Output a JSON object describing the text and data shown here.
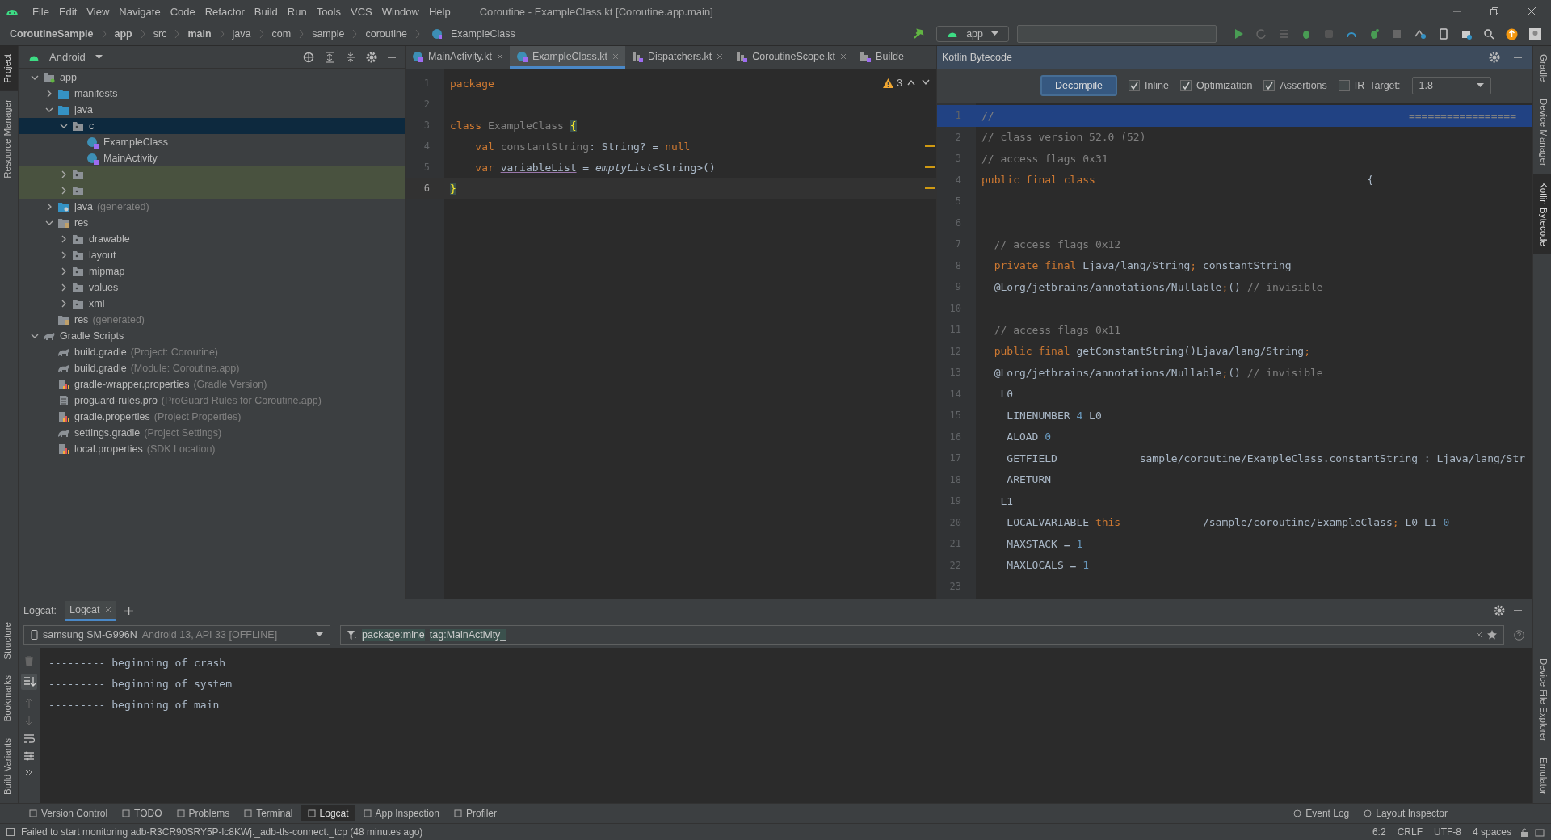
{
  "window": {
    "title": "Coroutine - ExampleClass.kt [Coroutine.app.main]",
    "menu": [
      "File",
      "Edit",
      "View",
      "Navigate",
      "Code",
      "Refactor",
      "Build",
      "Run",
      "Tools",
      "VCS",
      "Window",
      "Help"
    ]
  },
  "breadcrumbs": [
    {
      "label": "CoroutineSample",
      "bold": true
    },
    {
      "label": "app",
      "bold": true
    },
    {
      "label": "src",
      "bold": false
    },
    {
      "label": "main",
      "bold": true
    },
    {
      "label": "java",
      "bold": false
    },
    {
      "label": "com",
      "bold": false
    },
    {
      "label": "sample",
      "bold": false
    },
    {
      "label": "coroutine",
      "bold": false
    },
    {
      "label": "ExampleClass",
      "bold": false,
      "kind": "kotlin"
    }
  ],
  "run_config": "app",
  "left_stripe": [
    {
      "label": "Project",
      "selected": true
    },
    {
      "label": "Resource Manager",
      "selected": false
    },
    {
      "label": "Structure",
      "selected": false
    },
    {
      "label": "Bookmarks",
      "selected": false
    },
    {
      "label": "Build Variants",
      "selected": false
    }
  ],
  "right_stripe": [
    {
      "label": "Gradle",
      "selected": false
    },
    {
      "label": "Device Manager",
      "selected": false
    },
    {
      "label": "Kotlin Bytecode",
      "selected": true
    },
    {
      "label": "Device File Explorer",
      "selected": false
    },
    {
      "label": "Emulator",
      "selected": false
    }
  ],
  "project": {
    "view": "Android",
    "tree": [
      {
        "label": "app",
        "kind": "module",
        "expanded": true,
        "children": [
          {
            "label": "manifests",
            "kind": "folder",
            "expanded": false
          },
          {
            "label": "java",
            "kind": "folder",
            "expanded": true,
            "children": [
              {
                "label": "c",
                "kind": "package",
                "expanded": true,
                "selected": true,
                "children": [
                  {
                    "label": "ExampleClass",
                    "kind": "kotlin"
                  },
                  {
                    "label": "MainActivity",
                    "kind": "kotlin"
                  }
                ]
              },
              {
                "kind": "package",
                "expanded": false,
                "highlighted": true
              },
              {
                "kind": "package",
                "expanded": false,
                "highlighted": true
              }
            ]
          },
          {
            "label": "java",
            "note": "(generated)",
            "kind": "generated",
            "expanded": false
          },
          {
            "label": "res",
            "kind": "res",
            "expanded": true,
            "children": [
              {
                "label": "drawable",
                "kind": "package",
                "expanded": false
              },
              {
                "label": "layout",
                "kind": "package",
                "expanded": false
              },
              {
                "label": "mipmap",
                "kind": "package",
                "expanded": false
              },
              {
                "label": "values",
                "kind": "package",
                "expanded": false
              },
              {
                "label": "xml",
                "kind": "package",
                "expanded": false
              }
            ]
          },
          {
            "label": "res",
            "note": "(generated)",
            "kind": "res"
          }
        ]
      },
      {
        "label": "Gradle Scripts",
        "kind": "gradle",
        "expanded": true,
        "children": [
          {
            "label": "build.gradle",
            "note": "(Project: Coroutine)",
            "kind": "gradle"
          },
          {
            "label": "build.gradle",
            "note": "(Module: Coroutine.app)",
            "kind": "gradle"
          },
          {
            "label": "gradle-wrapper.properties",
            "note": "(Gradle Version)",
            "kind": "props"
          },
          {
            "label": "proguard-rules.pro",
            "note": "(ProGuard Rules for Coroutine.app)",
            "kind": "file"
          },
          {
            "label": "gradle.properties",
            "note": "(Project Properties)",
            "kind": "props"
          },
          {
            "label": "settings.gradle",
            "note": "(Project Settings)",
            "kind": "gradle"
          },
          {
            "label": "local.properties",
            "note": "(SDK Location)",
            "kind": "props"
          }
        ]
      }
    ]
  },
  "editor": {
    "tabs": [
      {
        "label": "MainActivity.kt",
        "kind": "kotlin",
        "selected": false
      },
      {
        "label": "ExampleClass.kt",
        "kind": "kotlin",
        "selected": true
      },
      {
        "label": "Dispatchers.kt",
        "kind": "library",
        "selected": false
      },
      {
        "label": "CoroutineScope.kt",
        "kind": "library",
        "selected": false
      },
      {
        "label": "Builde",
        "kind": "library",
        "selected": false
      }
    ],
    "warnings": "3",
    "lines": [
      {
        "number": "1",
        "current": false,
        "tokens": [
          {
            "text": "package",
            "kind": "kw"
          }
        ]
      },
      {
        "number": "2",
        "current": false
      },
      {
        "number": "3",
        "current": false,
        "tokens": [
          {
            "text": "class ",
            "kind": "kw"
          },
          {
            "text": "ExampleClass ",
            "kind": "unused"
          },
          {
            "text": "{",
            "kind": "brace"
          }
        ]
      },
      {
        "number": "4",
        "current": false,
        "tokens": [
          {
            "text": "    val ",
            "kind": "kw"
          },
          {
            "text": "constantString",
            "kind": "unused"
          },
          {
            "text": ": String? = ",
            "kind": "plain"
          },
          {
            "text": "null",
            "kind": "kw"
          }
        ]
      },
      {
        "number": "5",
        "current": false,
        "tokens": [
          {
            "text": "    var ",
            "kind": "kw"
          },
          {
            "text": "variableList",
            "kind": "underline"
          },
          {
            "text": " = ",
            "kind": "plain"
          },
          {
            "text": "emptyList",
            "kind": "italic"
          },
          {
            "text": "<String>()",
            "kind": "plain"
          }
        ]
      },
      {
        "number": "6",
        "current": true,
        "tokens": [
          {
            "text": "}",
            "kind": "brace"
          }
        ]
      }
    ]
  },
  "bytecode": {
    "title": "Kotlin Bytecode",
    "decompile": "Decompile",
    "options": [
      {
        "label": "Inline",
        "checked": true
      },
      {
        "label": "Optimization",
        "checked": true
      },
      {
        "label": "Assertions",
        "checked": true
      },
      {
        "label": "IR",
        "checked": false
      }
    ],
    "target_label": "Target:",
    "target": "1.8",
    "lines": [
      {
        "number": "1",
        "selected": true,
        "tokens": [
          {
            "text": "//",
            "kind": "comment"
          }
        ],
        "tail": "================="
      },
      {
        "number": "2",
        "selected": false,
        "tokens": [
          {
            "text": "// class version 52.0 (52)",
            "kind": "comment"
          }
        ]
      },
      {
        "number": "3",
        "selected": false,
        "tokens": [
          {
            "text": "// access flags 0x31",
            "kind": "comment"
          }
        ]
      },
      {
        "number": "4",
        "selected": false,
        "tokens": [
          {
            "text": "public final class",
            "kind": "kw"
          },
          {
            "text": "                                           {",
            "kind": "plain"
          }
        ]
      },
      {
        "number": "5",
        "selected": false
      },
      {
        "number": "6",
        "selected": false
      },
      {
        "number": "7",
        "selected": false,
        "tokens": [
          {
            "text": "  // access flags 0x12",
            "kind": "comment"
          }
        ]
      },
      {
        "number": "8",
        "selected": false,
        "tokens": [
          {
            "text": "  private final ",
            "kind": "kw"
          },
          {
            "text": "Ljava/lang/String",
            "kind": "plain"
          },
          {
            "text": ";",
            "kind": "kw"
          },
          {
            "text": " constantString",
            "kind": "plain"
          }
        ]
      },
      {
        "number": "9",
        "selected": false,
        "tokens": [
          {
            "text": "  @Lorg/jetbrains/annotations/Nullable",
            "kind": "plain"
          },
          {
            "text": ";",
            "kind": "kw"
          },
          {
            "text": "()",
            "kind": "plain"
          },
          {
            "text": " // invisible",
            "kind": "comment"
          }
        ]
      },
      {
        "number": "10",
        "selected": false
      },
      {
        "number": "11",
        "selected": false,
        "tokens": [
          {
            "text": "  // access flags 0x11",
            "kind": "comment"
          }
        ]
      },
      {
        "number": "12",
        "selected": false,
        "tokens": [
          {
            "text": "  public final ",
            "kind": "kw"
          },
          {
            "text": "getConstantString()Ljava/lang/String",
            "kind": "plain"
          },
          {
            "text": ";",
            "kind": "kw"
          }
        ]
      },
      {
        "number": "13",
        "selected": false,
        "tokens": [
          {
            "text": "  @Lorg/jetbrains/annotations/Nullable",
            "kind": "plain"
          },
          {
            "text": ";",
            "kind": "kw"
          },
          {
            "text": "()",
            "kind": "plain"
          },
          {
            "text": " // invisible",
            "kind": "comment"
          }
        ]
      },
      {
        "number": "14",
        "selected": false,
        "tokens": [
          {
            "text": "   L0",
            "kind": "plain"
          }
        ]
      },
      {
        "number": "15",
        "selected": false,
        "tokens": [
          {
            "text": "    LINENUMBER ",
            "kind": "plain"
          },
          {
            "text": "4",
            "kind": "num"
          },
          {
            "text": " L0",
            "kind": "plain"
          }
        ]
      },
      {
        "number": "16",
        "selected": false,
        "tokens": [
          {
            "text": "    ALOAD ",
            "kind": "plain"
          },
          {
            "text": "0",
            "kind": "num"
          }
        ]
      },
      {
        "number": "17",
        "selected": false,
        "tokens": [
          {
            "text": "    GETFIELD             sample/coroutine/ExampleClass.constantString : Ljava/lang/Str",
            "kind": "plain"
          }
        ]
      },
      {
        "number": "18",
        "selected": false,
        "tokens": [
          {
            "text": "    ARETURN",
            "kind": "plain"
          }
        ]
      },
      {
        "number": "19",
        "selected": false,
        "tokens": [
          {
            "text": "   L1",
            "kind": "plain"
          }
        ]
      },
      {
        "number": "20",
        "selected": false,
        "tokens": [
          {
            "text": "    LOCALVARIABLE ",
            "kind": "plain"
          },
          {
            "text": "this",
            "kind": "kw"
          },
          {
            "text": "             /sample/coroutine/ExampleClass",
            "kind": "plain"
          },
          {
            "text": ";",
            "kind": "kw"
          },
          {
            "text": " L0 L1 ",
            "kind": "plain"
          },
          {
            "text": "0",
            "kind": "num"
          }
        ]
      },
      {
        "number": "21",
        "selected": false,
        "tokens": [
          {
            "text": "    MAXSTACK = ",
            "kind": "plain"
          },
          {
            "text": "1",
            "kind": "num"
          }
        ]
      },
      {
        "number": "22",
        "selected": false,
        "tokens": [
          {
            "text": "    MAXLOCALS = ",
            "kind": "plain"
          },
          {
            "text": "1",
            "kind": "num"
          }
        ]
      },
      {
        "number": "23",
        "selected": false
      }
    ]
  },
  "logcat": {
    "label": "Logcat:",
    "tabs": [
      {
        "label": "Logcat",
        "selected": true
      }
    ],
    "device": "samsung SM-G996N",
    "device_detail": "Android 13, API 33 [OFFLINE]",
    "filter": [
      "package:mine",
      "tag:MainActivity_"
    ],
    "lines": [
      "--------- beginning of crash",
      "--------- beginning of system",
      "--------- beginning of main"
    ]
  },
  "bottom_tabs": [
    {
      "label": "Version Control",
      "selected": false
    },
    {
      "label": "TODO",
      "selected": false
    },
    {
      "label": "Problems",
      "selected": false
    },
    {
      "label": "Terminal",
      "selected": false
    },
    {
      "label": "Logcat",
      "selected": true
    },
    {
      "label": "App Inspection",
      "selected": false
    },
    {
      "label": "Profiler",
      "selected": false
    }
  ],
  "bottom_tabs_right": [
    "Event Log",
    "Layout Inspector"
  ],
  "status_bar": {
    "message": "Failed to start monitoring adb-R3CR90SRY5P-lc8KWj._adb-tls-connect._tcp (48 minutes ago)",
    "items": [
      "6:2",
      "CRLF",
      "UTF-8",
      "4 spaces"
    ]
  }
}
